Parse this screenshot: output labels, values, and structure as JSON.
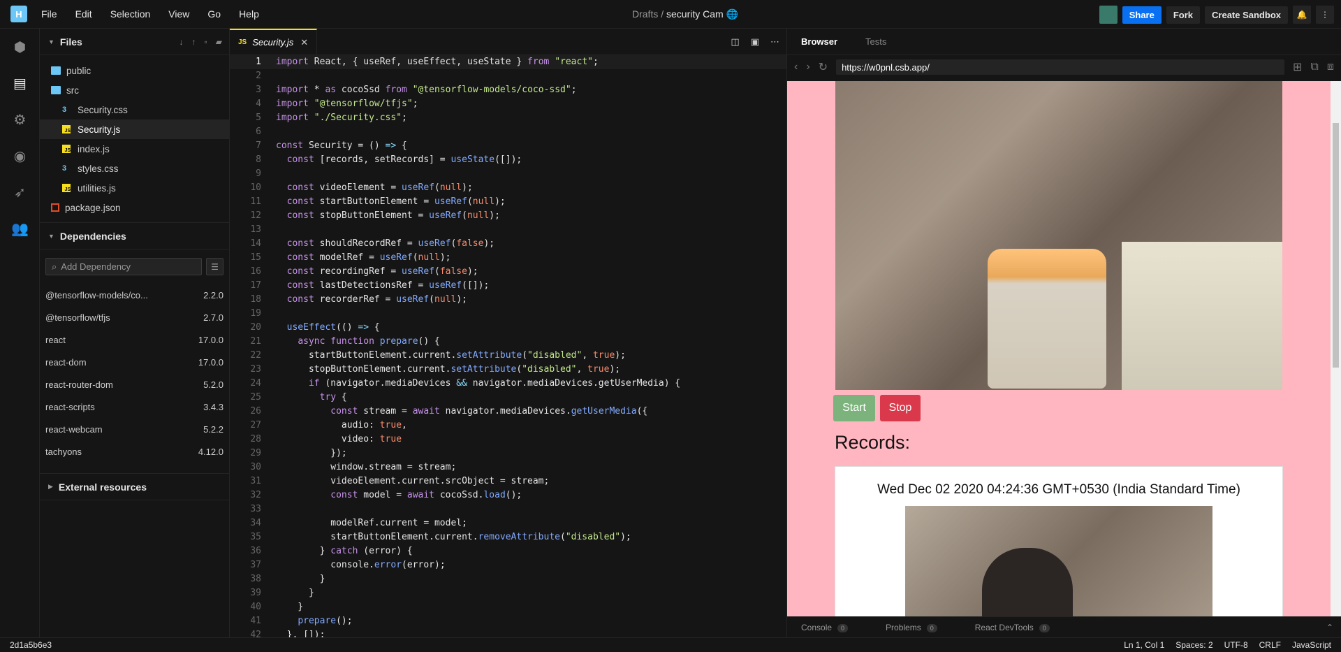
{
  "app": {
    "logo": "H",
    "menu": [
      "File",
      "Edit",
      "Selection",
      "View",
      "Go",
      "Help"
    ]
  },
  "breadcrumb": {
    "parent": "Drafts",
    "sep": "/",
    "name": "security Cam"
  },
  "actions": {
    "share": "Share",
    "fork": "Fork",
    "create": "Create Sandbox"
  },
  "files": {
    "title": "Files",
    "items": [
      {
        "name": "public",
        "type": "folder",
        "indent": 1
      },
      {
        "name": "src",
        "type": "folder",
        "indent": 1
      },
      {
        "name": "Security.css",
        "type": "css",
        "indent": 2
      },
      {
        "name": "Security.js",
        "type": "js",
        "indent": 2,
        "active": true
      },
      {
        "name": "index.js",
        "type": "js",
        "indent": 2
      },
      {
        "name": "styles.css",
        "type": "css",
        "indent": 2
      },
      {
        "name": "utilities.js",
        "type": "js",
        "indent": 2
      },
      {
        "name": "package.json",
        "type": "pkg",
        "indent": 1
      }
    ]
  },
  "dependencies": {
    "title": "Dependencies",
    "placeholder": "Add Dependency",
    "items": [
      {
        "name": "@tensorflow-models/co...",
        "version": "2.2.0"
      },
      {
        "name": "@tensorflow/tfjs",
        "version": "2.7.0"
      },
      {
        "name": "react",
        "version": "17.0.0"
      },
      {
        "name": "react-dom",
        "version": "17.0.0"
      },
      {
        "name": "react-router-dom",
        "version": "5.2.0"
      },
      {
        "name": "react-scripts",
        "version": "3.4.3"
      },
      {
        "name": "react-webcam",
        "version": "5.2.2"
      },
      {
        "name": "tachyons",
        "version": "4.12.0"
      }
    ]
  },
  "external": "External resources",
  "editor": {
    "tab": "Security.js",
    "lines": [
      "import React, { useRef, useEffect, useState } from \"react\";",
      "",
      "import * as cocoSsd from \"@tensorflow-models/coco-ssd\";",
      "import \"@tensorflow/tfjs\";",
      "import \"./Security.css\";",
      "",
      "const Security = () => {",
      "  const [records, setRecords] = useState([]);",
      "",
      "  const videoElement = useRef(null);",
      "  const startButtonElement = useRef(null);",
      "  const stopButtonElement = useRef(null);",
      "",
      "  const shouldRecordRef = useRef(false);",
      "  const modelRef = useRef(null);",
      "  const recordingRef = useRef(false);",
      "  const lastDetectionsRef = useRef([]);",
      "  const recorderRef = useRef(null);",
      "",
      "  useEffect(() => {",
      "    async function prepare() {",
      "      startButtonElement.current.setAttribute(\"disabled\", true);",
      "      stopButtonElement.current.setAttribute(\"disabled\", true);",
      "      if (navigator.mediaDevices && navigator.mediaDevices.getUserMedia) {",
      "        try {",
      "          const stream = await navigator.mediaDevices.getUserMedia({",
      "            audio: true,",
      "            video: true",
      "          });",
      "          window.stream = stream;",
      "          videoElement.current.srcObject = stream;",
      "          const model = await cocoSsd.load();",
      "",
      "          modelRef.current = model;",
      "          startButtonElement.current.removeAttribute(\"disabled\");",
      "        } catch (error) {",
      "          console.error(error);",
      "        }",
      "      }",
      "    }",
      "    prepare();",
      "  }, []);"
    ]
  },
  "preview": {
    "tabs": [
      "Browser",
      "Tests"
    ],
    "url": "https://w0pnl.csb.app/",
    "start": "Start",
    "stop": "Stop",
    "records_heading": "Records:",
    "record_time": "Wed Dec 02 2020 04:24:36 GMT+0530 (India Standard Time)",
    "footer": [
      {
        "label": "Console",
        "count": "0"
      },
      {
        "label": "Problems",
        "count": "0"
      },
      {
        "label": "React DevTools",
        "count": "0"
      }
    ]
  },
  "status": {
    "hash": "2d1a5b6e3",
    "position": "Ln 1, Col 1",
    "spaces": "Spaces: 2",
    "encoding": "UTF-8",
    "eol": "CRLF",
    "language": "JavaScript"
  }
}
